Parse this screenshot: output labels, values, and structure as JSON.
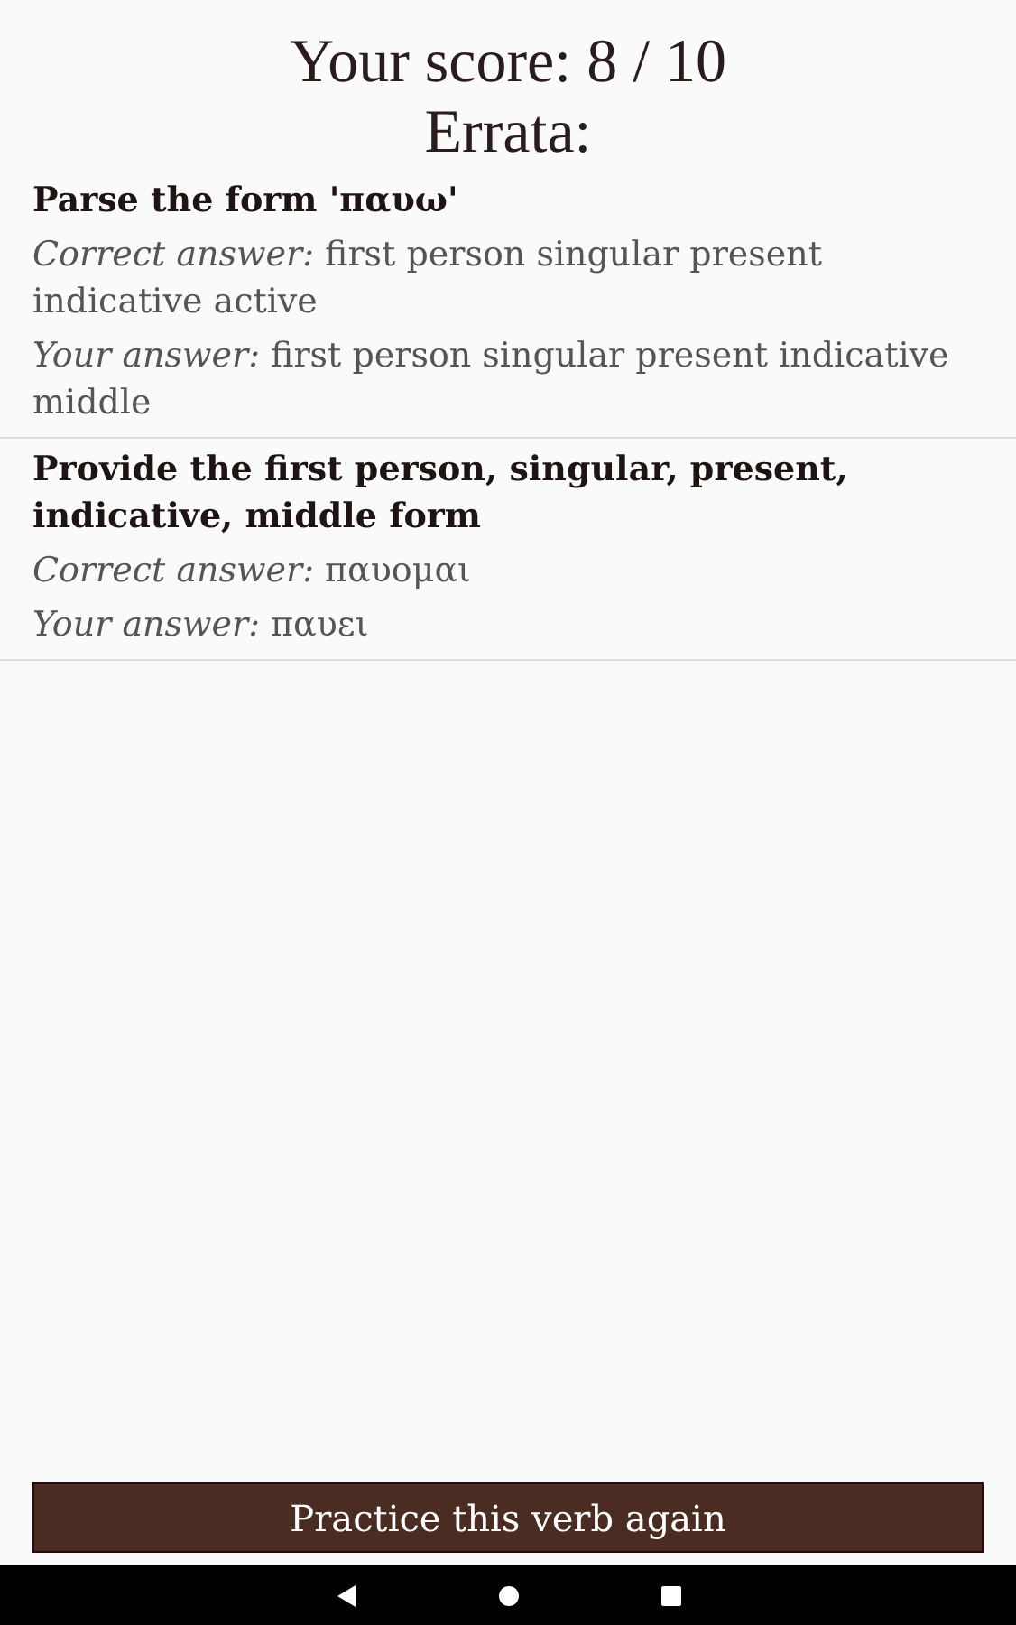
{
  "score": "Your score: 8 / 10",
  "errata_title": "Errata:",
  "errata": [
    {
      "question": "Parse the form 'παυω'",
      "correct": "*Correct answer:*  first person singular present indicative active",
      "yours": "*Your answer:*  first person singular present indicative middle"
    },
    {
      "question": "Provide the first person, singular, present, indicative, middle form",
      "correct": "*Correct answer:*  παυομαι",
      "yours": "*Your answer:*  παυει"
    }
  ],
  "button": "Practice this verb again"
}
